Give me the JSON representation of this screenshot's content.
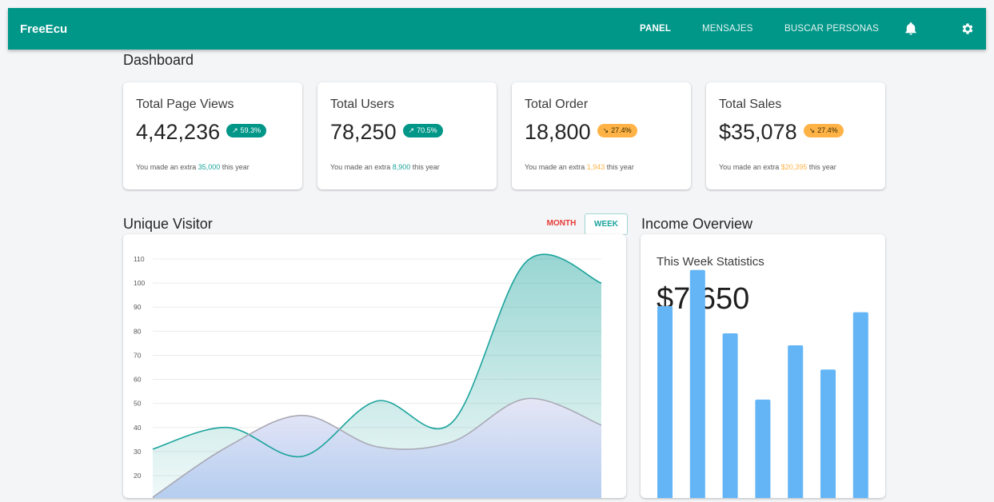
{
  "app": {
    "brand": "FreeEcu",
    "nav": [
      "PANEL",
      "MENSAJES",
      "BUSCAR PERSONAS"
    ],
    "active_nav": "PANEL",
    "icons": [
      "bell-icon",
      "gear-icon"
    ],
    "color_primary": "#009688"
  },
  "page": {
    "title": "Dashboard"
  },
  "stats": [
    {
      "title": "Total Page Views",
      "value": "4,42,236",
      "badge": "59.3%",
      "trend": "up",
      "sub_prefix": "You made an extra ",
      "sub_value": "35,000",
      "sub_suffix": " this year",
      "accent": "#1ba39c"
    },
    {
      "title": "Total Users",
      "value": "78,250",
      "badge": "70.5%",
      "trend": "up",
      "sub_prefix": "You made an extra ",
      "sub_value": "8,900",
      "sub_suffix": " this year",
      "accent": "#1ba39c"
    },
    {
      "title": "Total Order",
      "value": "18,800",
      "badge": "27.4%",
      "trend": "down",
      "sub_prefix": "You made an extra ",
      "sub_value": "1,943",
      "sub_suffix": " this year",
      "accent": "#ffb347"
    },
    {
      "title": "Total Sales",
      "value": "$35,078",
      "badge": "27.4%",
      "trend": "down",
      "sub_prefix": "You made an extra ",
      "sub_value": "$20,395",
      "sub_suffix": " this year",
      "accent": "#ffb347"
    }
  ],
  "visitor": {
    "title": "Unique Visitor",
    "toggle_month": "MONTH",
    "toggle_week": "WEEK",
    "active_toggle": "MONTH"
  },
  "income": {
    "title": "Income Overview",
    "subtitle": "This Week Statistics",
    "amount": "$7,650"
  },
  "chart_data": [
    {
      "type": "area",
      "ylim": [
        20,
        110
      ],
      "yticks": [
        110,
        100,
        90,
        80,
        70,
        60,
        50,
        40,
        30,
        20
      ],
      "grid": true,
      "x": [
        0,
        1,
        2,
        3,
        4,
        5,
        6
      ],
      "series": [
        {
          "color": "#1ba39c",
          "values": [
            31,
            40,
            28,
            51,
            42,
            109,
            100
          ]
        },
        {
          "color": "#a9a9b5",
          "values": [
            11,
            32,
            45,
            32,
            34,
            52,
            41
          ]
        }
      ]
    },
    {
      "type": "bar",
      "color": "#64b5f6",
      "values": [
        61,
        73,
        52,
        30,
        48,
        40,
        59
      ]
    }
  ]
}
